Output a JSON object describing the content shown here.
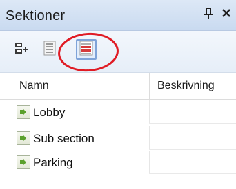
{
  "panel": {
    "title": "Sektioner",
    "pin_label": "p",
    "close_label": "×"
  },
  "toolbar": {
    "buttons": [
      {
        "icon": "expand-collapse-icon"
      },
      {
        "icon": "list-view-icon"
      },
      {
        "icon": "section-view-icon",
        "active": true
      }
    ],
    "highlight_color": "#e01b24"
  },
  "table": {
    "columns": [
      "Namn",
      "Beskrivning"
    ],
    "rows": [
      {
        "name": "Lobby",
        "description": ""
      },
      {
        "name": "Sub section",
        "description": ""
      },
      {
        "name": "Parking",
        "description": ""
      }
    ]
  }
}
